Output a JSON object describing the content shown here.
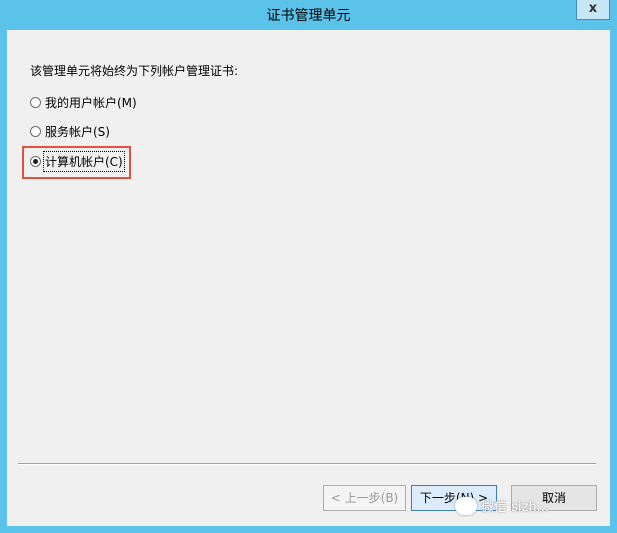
{
  "window": {
    "title": "证书管理单元",
    "close_label": "x"
  },
  "dialog": {
    "instruction": "该管理单元将始终为下列帐户管理证书:",
    "options": [
      {
        "label": "我的用户帐户(M)",
        "selected": false
      },
      {
        "label": "服务帐户(S)",
        "selected": false
      },
      {
        "label": "计算机帐户(C)",
        "selected": true
      }
    ]
  },
  "buttons": {
    "back": "< 上一步(B)",
    "next": "下一步(N) >",
    "cancel": "取消"
  },
  "watermark": {
    "text": "微信 sizh..."
  },
  "colors": {
    "titlebar": "#5bc3ea",
    "highlight": "#e2523a"
  }
}
